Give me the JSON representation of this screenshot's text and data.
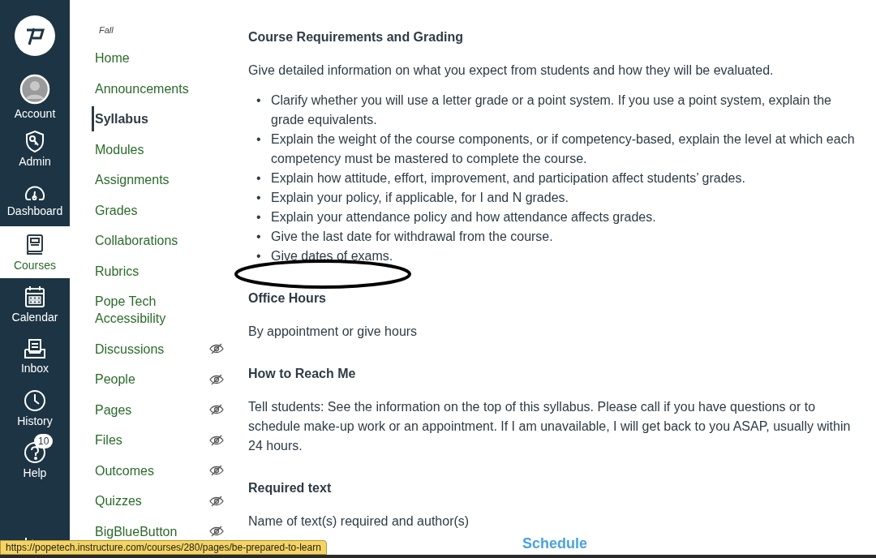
{
  "global_nav": {
    "items": [
      {
        "label": "Account",
        "selected": false
      },
      {
        "label": "Admin",
        "selected": false
      },
      {
        "label": "Dashboard",
        "selected": false
      },
      {
        "label": "Courses",
        "selected": true
      },
      {
        "label": "Calendar",
        "selected": false
      },
      {
        "label": "Inbox",
        "selected": false
      },
      {
        "label": "History",
        "selected": false
      },
      {
        "label": "Help",
        "selected": false,
        "badge": "10"
      }
    ]
  },
  "course_nav": {
    "term": "Fall",
    "items": [
      {
        "label": "Home",
        "selected": false,
        "hidden": false
      },
      {
        "label": "Announcements",
        "selected": false,
        "hidden": false
      },
      {
        "label": "Syllabus",
        "selected": true,
        "hidden": false
      },
      {
        "label": "Modules",
        "selected": false,
        "hidden": false
      },
      {
        "label": "Assignments",
        "selected": false,
        "hidden": false
      },
      {
        "label": "Grades",
        "selected": false,
        "hidden": false
      },
      {
        "label": "Collaborations",
        "selected": false,
        "hidden": false
      },
      {
        "label": "Rubrics",
        "selected": false,
        "hidden": false
      },
      {
        "label": "Pope Tech Accessibility",
        "selected": false,
        "hidden": false
      },
      {
        "label": "Discussions",
        "selected": false,
        "hidden": true
      },
      {
        "label": "People",
        "selected": false,
        "hidden": true
      },
      {
        "label": "Pages",
        "selected": false,
        "hidden": true
      },
      {
        "label": "Files",
        "selected": false,
        "hidden": true
      },
      {
        "label": "Outcomes",
        "selected": false,
        "hidden": true
      },
      {
        "label": "Quizzes",
        "selected": false,
        "hidden": true
      },
      {
        "label": "BigBlueButton",
        "selected": false,
        "hidden": true
      }
    ]
  },
  "content": {
    "sections": [
      {
        "heading": "Course Requirements and Grading",
        "bullet_marker": "•",
        "paragraph": "Give detailed information on what you expect from students and how they will be evaluated.",
        "bullets": [
          "Clarify whether you will use a letter grade or a point system. If you use a point system, explain the grade equivalents.",
          "Explain the weight of the course components, or if competency-based, explain the level at which each competency must be mastered to complete the course.",
          "Explain how attitude, effort, improvement, and participation affect students’ grades.",
          "Explain your policy, if applicable, for I and N grades.",
          "Explain your attendance policy and how attendance affects grades.",
          "Give the last date for withdrawal from the course.",
          "Give dates of exams."
        ],
        "annotated": true
      },
      {
        "heading": "Office Hours",
        "paragraph": "By appointment or give hours"
      },
      {
        "heading": "How to Reach Me",
        "paragraph": "Tell students: See the information on the top of this syllabus. Please call if you have questions or to schedule make-up work or an appointment. If I am unavailable, I will get back to you ASAP, usually within 24 hours."
      },
      {
        "heading": "Required text",
        "paragraph": "Name of text(s) required and author(s)"
      }
    ],
    "next_heading": "Schedule"
  },
  "status_url": "https://popetech.instructure.com/courses/280/pages/be-prepared-to-learn"
}
